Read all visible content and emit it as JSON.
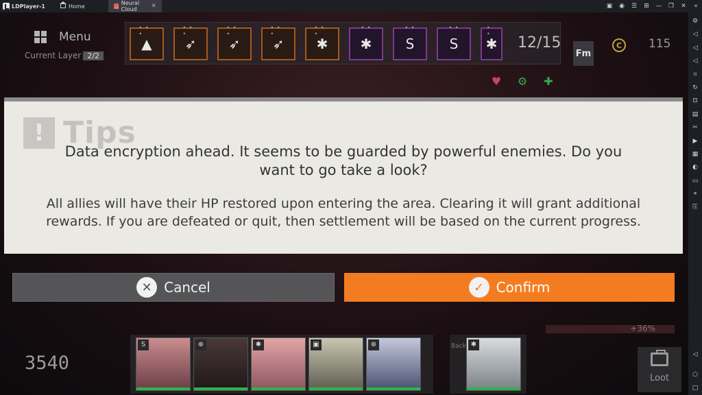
{
  "emulator": {
    "app_name": "LDPlayer-1",
    "tabs": [
      {
        "label": "Home"
      },
      {
        "label": "Neural Cloud"
      }
    ],
    "close_glyph": "✕",
    "window_controls": [
      "▣",
      "◉",
      "☰",
      "⊞",
      "—",
      "❐",
      "✕",
      "«"
    ],
    "sidebar_icons": [
      "settings-icon",
      "volume-up-icon",
      "volume-down-icon",
      "volume-mute-icon",
      "screenshot-icon",
      "rotate-icon",
      "apk-install-icon",
      "multi-instance-icon",
      "cut-icon",
      "record-icon",
      "operation-icon",
      "sync-icon",
      "folder-icon",
      "location-icon",
      "shake-icon"
    ]
  },
  "game": {
    "menu_label": "Menu",
    "layer_label": "Current Layer",
    "layer_value": "2/2",
    "buff_count": "12/15",
    "fm_label": "Fm",
    "coin_symbol": "C",
    "coin_amount": "115",
    "bonus_text": "+36%",
    "power": "3540",
    "back_label": "Back",
    "loot_label": "Loot"
  },
  "dialog": {
    "title": "Tips",
    "message": "Data encryption ahead. It seems to be guarded by powerful enemies. Do you want to go take a look?",
    "detail": "All allies will have their HP restored upon entering the area. Clearing it will grant additional rewards. If you are defeated or quit, then settlement will be based on the current progress.",
    "cancel_label": "Cancel",
    "confirm_label": "Confirm",
    "accent_color": "#f47c20"
  },
  "team": {
    "roles": [
      "S",
      "⊕",
      "✱",
      "▣",
      "⊕"
    ],
    "back_role": "✱"
  }
}
